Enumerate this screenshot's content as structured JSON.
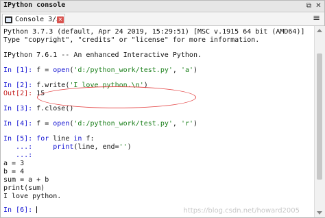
{
  "window": {
    "title": "IPython console"
  },
  "tab": {
    "label": "Console 3/A",
    "close_glyph": "✕"
  },
  "window_buttons": {
    "float_glyph": "⧉",
    "close_glyph": "✕"
  },
  "options_glyph": "≡",
  "console": {
    "banner1": "Python 3.7.3 (default, Apr 24 2019, 15:29:51) [MSC v.1915 64 bit (AMD64)]",
    "banner2": "Type \"copyright\", \"credits\" or \"license\" for more information.",
    "banner3": "IPython 7.6.1 -- An enhanced Interactive Python.",
    "in1_prompt": "In [1]: ",
    "in1_code_a": "f = ",
    "in1_code_b": "open",
    "in1_code_c": "(",
    "in1_code_d": "'d:/python_work/test.py'",
    "in1_code_e": ", ",
    "in1_code_f": "'a'",
    "in1_code_g": ")",
    "in2_prompt": "In [2]: ",
    "in2_code_a": "f.write(",
    "in2_code_b": "'I love python.\\n'",
    "in2_code_c": ")",
    "out2_prompt": "Out[2]: ",
    "out2_value": "15",
    "in3_prompt": "In [3]: ",
    "in3_code": "f.close()",
    "in4_prompt": "In [4]: ",
    "in4_code_a": "f = ",
    "in4_code_b": "open",
    "in4_code_c": "(",
    "in4_code_d": "'d:/python_work/test.py'",
    "in4_code_e": ", ",
    "in4_code_f": "'r'",
    "in4_code_g": ")",
    "in5_prompt": "In [5]: ",
    "in5_kw_for": "for",
    "in5_mid": " line ",
    "in5_kw_in": "in",
    "in5_end": " f:",
    "cont1_prompt": "   ...: ",
    "cont1_indent": "    ",
    "cont1_print": "print",
    "cont1_args_a": "(line, end=",
    "cont1_args_b": "''",
    "cont1_args_c": ")",
    "cont2_prompt": "   ...: ",
    "output_lines": [
      "a = 3",
      "b = 4",
      "sum = a + b",
      "print(sum)",
      "I love python."
    ],
    "in6_prompt": "In [6]: "
  },
  "watermark": "https://blog.csdn.net/howard2005",
  "colors": {
    "prompt_in": "#1414d2",
    "prompt_out": "#c42020",
    "string": "#1a7f1a",
    "highlight_ring": "#e54a4a"
  }
}
